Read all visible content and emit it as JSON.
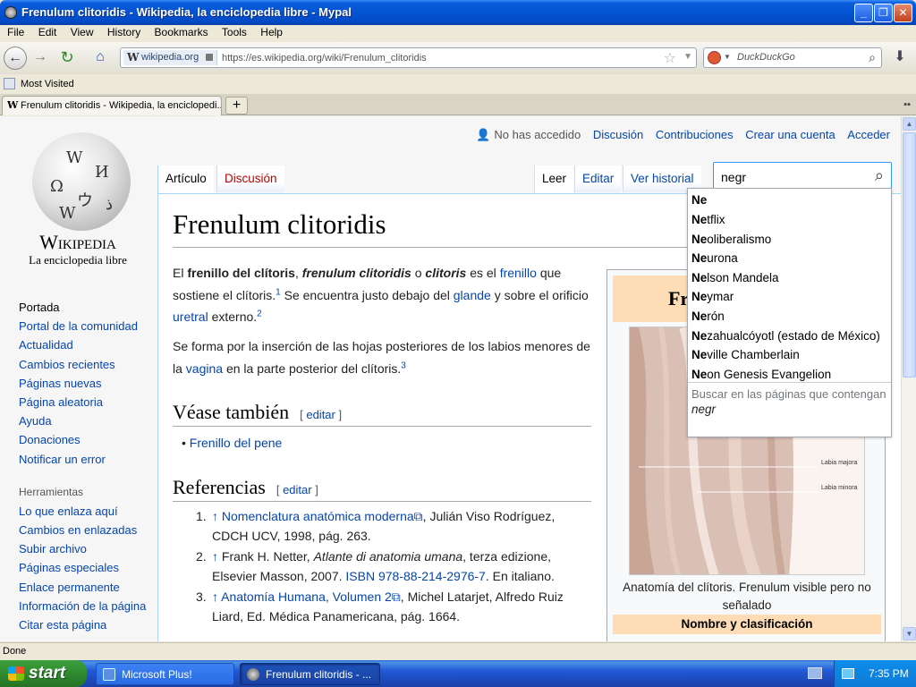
{
  "window": {
    "title": "Frenulum clitoridis - Wikipedia, la enciclopedia libre - Mypal",
    "minimize": "_",
    "maximize": "❐",
    "close": "✕"
  },
  "menu": [
    "File",
    "Edit",
    "View",
    "History",
    "Bookmarks",
    "Tools",
    "Help"
  ],
  "nav": {
    "site_badge": "wikipedia.org",
    "url": "https://es.wikipedia.org/wiki/Frenulum_clitoridis",
    "search_engine_placeholder": "DuckDuckGo"
  },
  "bookmarks": {
    "most_visited": "Most Visited"
  },
  "tab": {
    "title": "Frenulum clitoridis - Wikipedia, la enciclopedi...",
    "new_tab": "+"
  },
  "status": "Done",
  "logo": {
    "wordmark": "Wikipedia",
    "tagline": "La enciclopedia libre"
  },
  "sidebar": {
    "items": [
      "Portada",
      "Portal de la comunidad",
      "Actualidad",
      "Cambios recientes",
      "Páginas nuevas",
      "Página aleatoria",
      "Ayuda",
      "Donaciones",
      "Notificar un error"
    ],
    "tools_heading": "Herramientas",
    "tools": [
      "Lo que enlaza aquí",
      "Cambios en enlazadas",
      "Subir archivo",
      "Páginas especiales",
      "Enlace permanente",
      "Información de la página",
      "Citar esta página"
    ]
  },
  "personal": {
    "not_logged": "No has accedido",
    "links": [
      "Discusión",
      "Contribuciones",
      "Crear una cuenta",
      "Acceder"
    ]
  },
  "page_tabs": {
    "article": "Artículo",
    "talk": "Discusión",
    "read": "Leer",
    "edit": "Editar",
    "history": "Ver historial"
  },
  "search": {
    "query": "negr",
    "suggestions": [
      {
        "bold": "Ne",
        "rest": ""
      },
      {
        "bold": "Ne",
        "rest": "tflix"
      },
      {
        "bold": "Ne",
        "rest": "oliberalismo"
      },
      {
        "bold": "Ne",
        "rest": "urona"
      },
      {
        "bold": "Ne",
        "rest": "lson Mandela"
      },
      {
        "bold": "Ne",
        "rest": "ymar"
      },
      {
        "bold": "Ne",
        "rest": "rón"
      },
      {
        "bold": "Ne",
        "rest": "zahualcóyotl (estado de México)"
      },
      {
        "bold": "Ne",
        "rest": "ville Chamberlain"
      },
      {
        "bold": "Ne",
        "rest": "on Genesis Evangelion"
      }
    ],
    "containing_label": "Buscar en las páginas que contengan",
    "containing_query": "negr"
  },
  "article": {
    "title": "Frenulum clitoridis",
    "p1": {
      "t1": "El ",
      "b1": "frenillo del clítoris",
      "t2": ", ",
      "bi1": "frenulum clitoridis",
      "t3": " o ",
      "bi2": "clitoris",
      "t4": " es el ",
      "l1": "frenillo",
      "t5": " que sostiene el clítoris.",
      "s1": "1",
      "t6": "  Se encuentra justo debajo del ",
      "l2": "glande",
      "t7": " y sobre el orificio ",
      "l3": "uretral",
      "t8": " externo.",
      "s2": "2"
    },
    "p2": {
      "t1": "Se forma por la inserción de las hojas posteriores de los labios menores de la ",
      "l1": "vagina",
      "t2": " en la parte posterior del clítoris.",
      "s1": "3"
    },
    "see_also": {
      "heading": "Véase también",
      "edit": "editar",
      "item": "Frenillo del pene"
    },
    "references": {
      "heading": "Referencias",
      "edit": "editar",
      "items": [
        {
          "n": "1.",
          "link": "Nomenclatura anatómica moderna",
          "rest": ", Julián Viso Rodríguez, CDCH UCV, 1998, pág. 263."
        },
        {
          "n": "2.",
          "pre": "Frank H. Netter, ",
          "em": "Atlante di anatomia umana",
          "mid": ", terza edizione, Elsevier Masson, 2007. ",
          "isbn": "ISBN 978-88-214-2976-7",
          "post": ". En italiano."
        },
        {
          "n": "3.",
          "link": "Anatomía Humana, Volumen 2",
          "rest": ", Michel Latarjet, Alfredo Ruiz Liard, Ed. Médica Panamericana, pág. 1664."
        }
      ]
    }
  },
  "infobox": {
    "title_partial": "Fr",
    "image_labels": {
      "labia_majora": "Labia majora",
      "labia_minora": "Labia minora"
    },
    "caption": "Anatomía del clítoris. Frenulum visible pero no señalado",
    "section": "Nombre y clasificación"
  },
  "taskbar": {
    "start": "start",
    "tasks": [
      "Microsoft Plus!",
      "Frenulum clitoridis - ..."
    ],
    "clock": "7:35 PM"
  }
}
